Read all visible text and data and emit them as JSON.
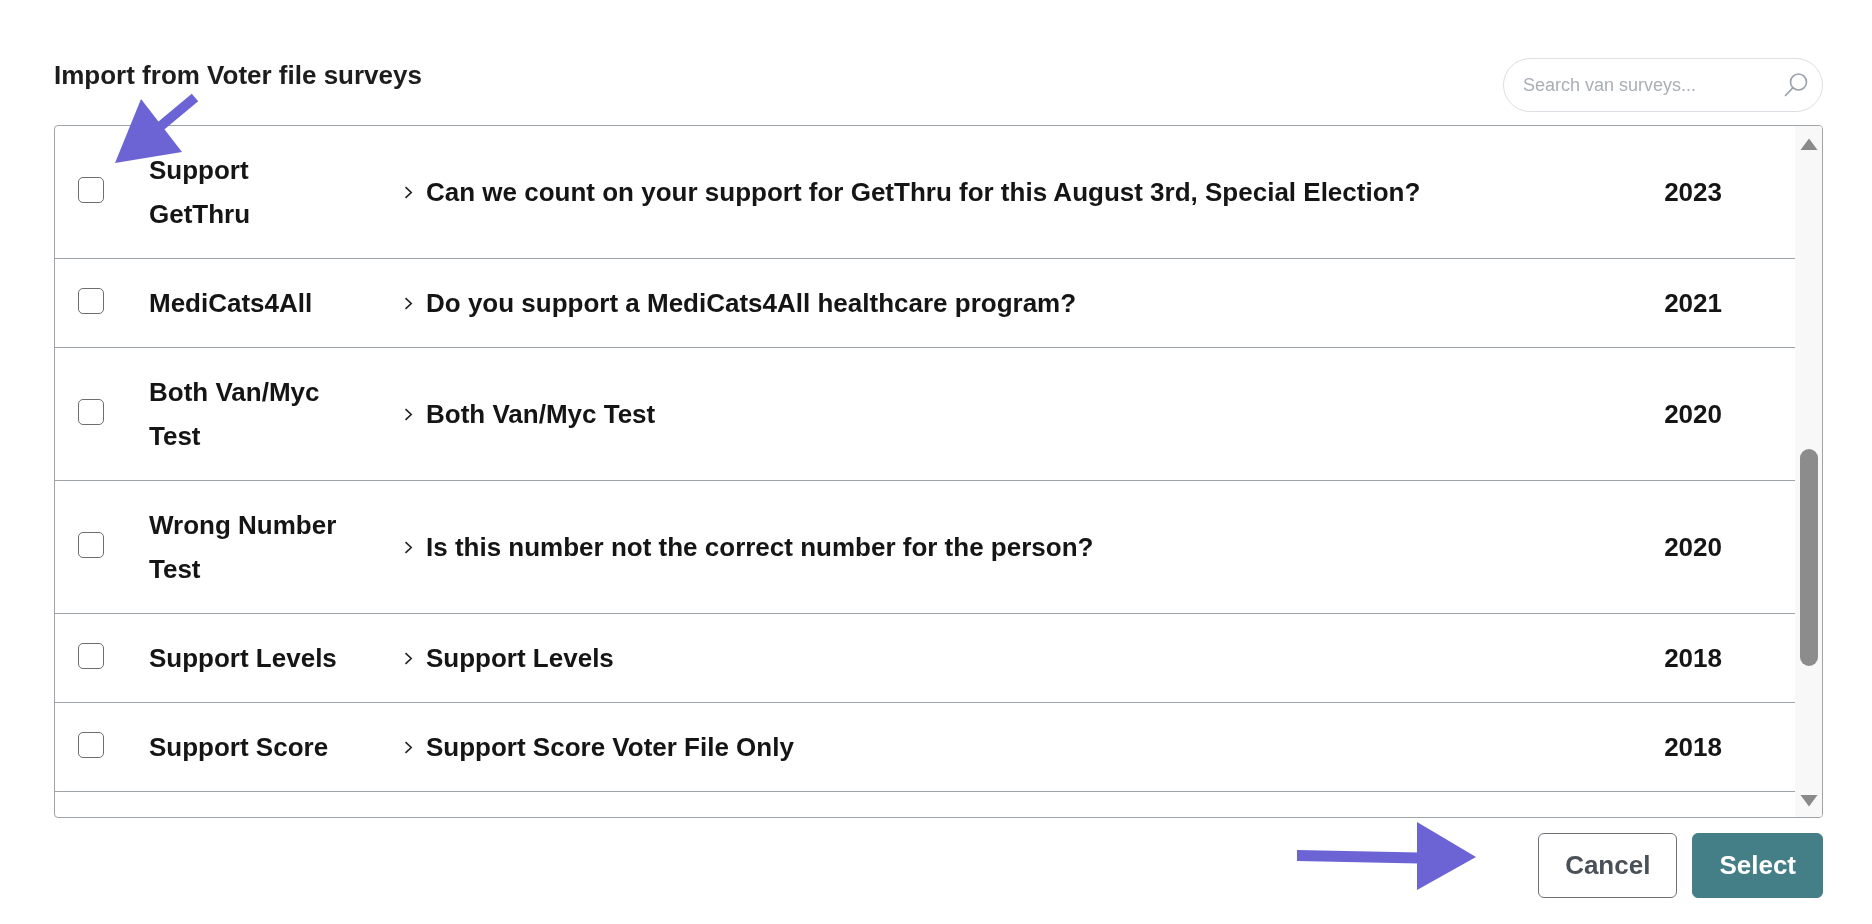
{
  "dialog": {
    "title": "Import from Voter file surveys",
    "search": {
      "placeholder": "Search van surveys..."
    }
  },
  "surveys": [
    {
      "name": "Support GetThru",
      "question": "Can we count on your support for GetThru for this August 3rd, Special Election?",
      "year": "2023",
      "checked": false
    },
    {
      "name": "MediCats4All",
      "question": "Do you support a MediCats4All healthcare program?",
      "year": "2021",
      "checked": false
    },
    {
      "name": "Both Van/Myc Test",
      "question": "Both Van/Myc Test",
      "year": "2020",
      "checked": false
    },
    {
      "name": "Wrong Number Test",
      "question": "Is this number not the correct number for the person?",
      "year": "2020",
      "checked": false
    },
    {
      "name": "Support Levels",
      "question": "Support Levels",
      "year": "2018",
      "checked": false
    },
    {
      "name": "Support Score",
      "question": "Support Score Voter File Only",
      "year": "2018",
      "checked": false
    }
  ],
  "buttons": [
    {
      "label": "Cancel",
      "kind": "secondary"
    },
    {
      "label": "Select",
      "kind": "primary"
    }
  ]
}
